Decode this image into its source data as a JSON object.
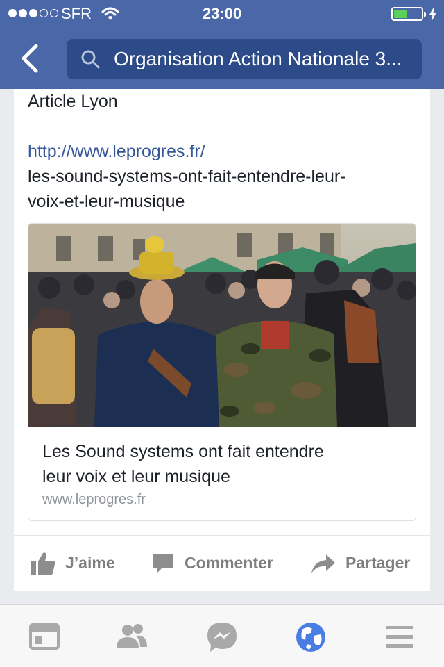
{
  "status_bar": {
    "carrier": "SFR",
    "time": "23:00",
    "signal_bars_filled": 3,
    "signal_bars_total": 5,
    "battery_level": 0.5
  },
  "nav": {
    "search_text": "Organisation Action Nationale 3..."
  },
  "post": {
    "line1": "Article Lyon",
    "link_part1": "http://www.leprogres.fr/",
    "link_part2": "les-sound-systems-ont-fait-entendre-leur-",
    "link_part3": "voix-et-leur-musique"
  },
  "preview": {
    "title_line1": "Les Sound systems ont fait entendre",
    "title_line2": "leur voix et leur musique",
    "domain": "www.leprogres.fr"
  },
  "actions": {
    "like": "J’aime",
    "comment": "Commenter",
    "share": "Partager"
  },
  "tabs": [
    "news-feed",
    "friend-requests",
    "messenger",
    "notifications",
    "more"
  ],
  "colors": {
    "header_blue": "#4a67a7",
    "search_field": "#2d4b88",
    "link": "#365899",
    "active_tab": "#4a7de4"
  }
}
